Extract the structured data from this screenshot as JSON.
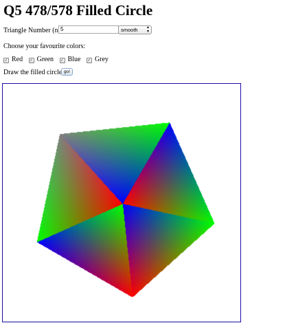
{
  "page": {
    "title": "Q5 478/578 Filled Circle"
  },
  "controls": {
    "triangle_label": "Triangle Number (n):",
    "triangle_value": "5",
    "shading_selected": "smooth",
    "colors_prompt": "Choose your favourite colors:",
    "colors": [
      {
        "label": "Red",
        "checked": true,
        "hex": "#ff0000"
      },
      {
        "label": "Green",
        "checked": true,
        "hex": "#00ff00"
      },
      {
        "label": "Blue",
        "checked": true,
        "hex": "#0000ff"
      },
      {
        "label": "Grey",
        "checked": true,
        "hex": "#808080"
      }
    ],
    "draw_label": "Draw the filled circle:",
    "go_label": "go!"
  },
  "canvas": {
    "border_color": "#1a0ba3",
    "background": "#ffffff",
    "triangles": 5,
    "rotation_deg": -60
  }
}
